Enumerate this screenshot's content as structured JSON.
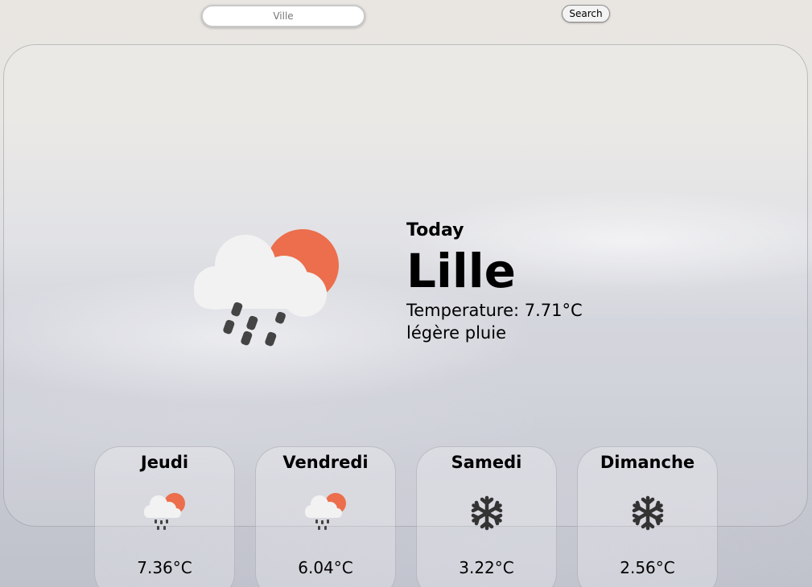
{
  "search": {
    "placeholder": "Ville",
    "button_label": "Search"
  },
  "current": {
    "heading": "Today",
    "city": "Lille",
    "temperature_text": "Temperature: 7.71°C",
    "description": "légère pluie",
    "icon": "rain-sun-cloud-icon"
  },
  "forecast": [
    {
      "day": "Jeudi",
      "temp": "7.36°C",
      "icon": "rain-sun-cloud-icon"
    },
    {
      "day": "Vendredi",
      "temp": "6.04°C",
      "icon": "rain-sun-cloud-icon"
    },
    {
      "day": "Samedi",
      "temp": "3.22°C",
      "icon": "snowflake-icon"
    },
    {
      "day": "Dimanche",
      "temp": "2.56°C",
      "icon": "snowflake-icon"
    }
  ],
  "colors": {
    "sun": "#ec6e4c",
    "cloud": "#f2f2f2",
    "rain": "#444444",
    "snow": "#333333"
  }
}
